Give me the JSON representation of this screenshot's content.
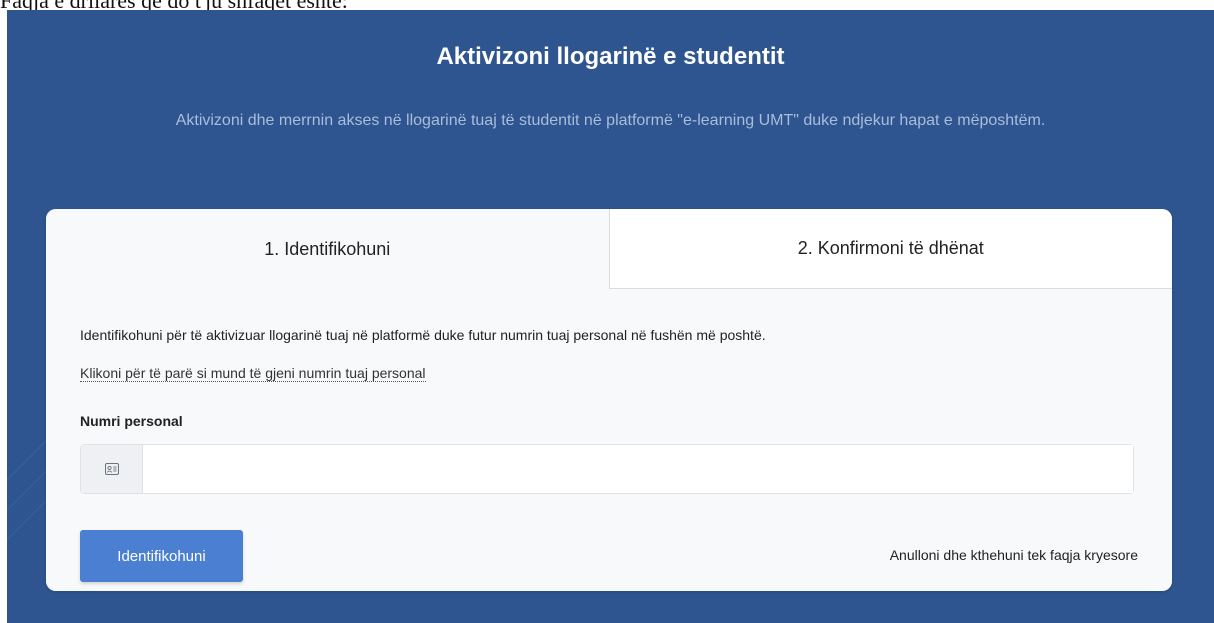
{
  "document_caption": "Faqja e drilares që do t'ju shfaqet është:",
  "hero": {
    "title": "Aktivizoni llogarinë e studentit",
    "subtitle": "Aktivizoni dhe merrnin akses në llogarinë tuaj të studentit  në platformë \"e-learning UMT\" duke ndjekur hapat e mëposhtëm."
  },
  "tabs": [
    {
      "label": "1. Identifikohuni",
      "active": true
    },
    {
      "label": "2. Konfirmoni të dhënat",
      "active": false
    }
  ],
  "form": {
    "intro": "Identifikohuni për të aktivizuar llogarinë tuaj në platformë duke futur numrin tuaj personal në fushën më poshtë.",
    "help_link": "Klikoni për të parë si mund të gjeni numrin tuaj personal",
    "field_label": "Numri personal",
    "field_value": "",
    "field_placeholder": "",
    "field_icon": "id-card-icon",
    "submit_label": "Identifikohuni",
    "cancel_label": "Anulloni dhe kthehuni tek faqja kryesore"
  },
  "colors": {
    "hero_background": "#2e5590",
    "subtitle_text": "#a9bdda",
    "primary_button": "#4a7fd1",
    "card_body": "#f8f9fa"
  }
}
